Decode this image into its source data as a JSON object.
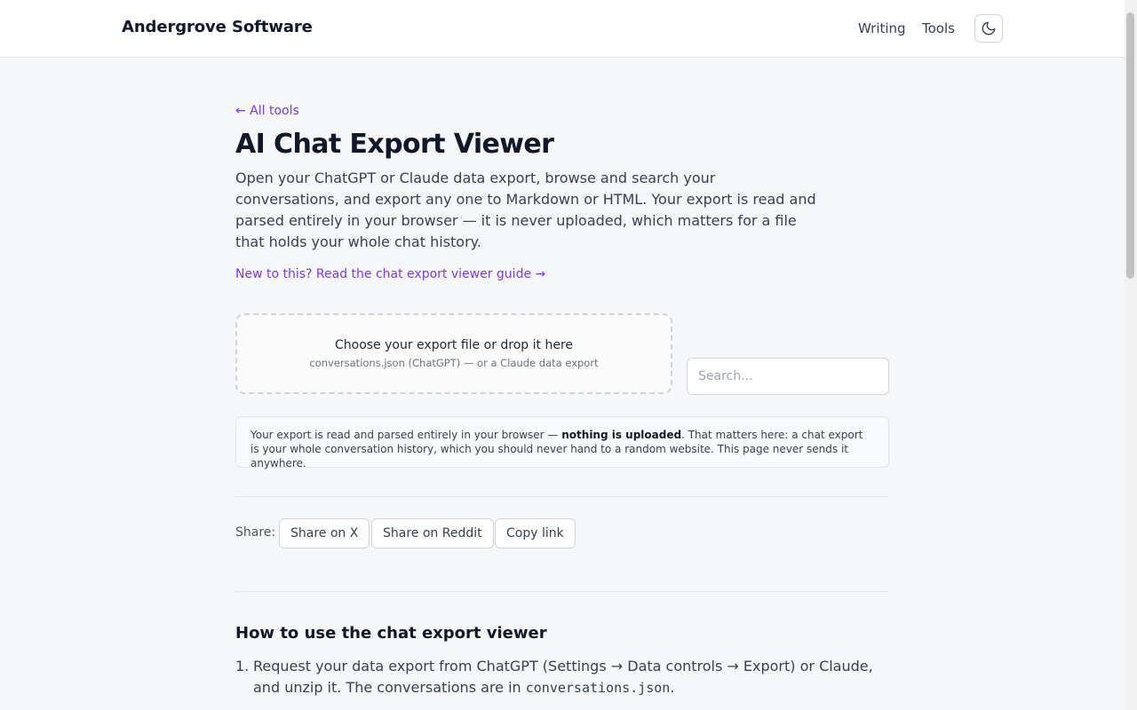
{
  "header": {
    "brand": "Andergrove Software",
    "nav": [
      {
        "label": "Writing"
      },
      {
        "label": "Tools"
      }
    ],
    "theme_toggle_icon": "moon-icon"
  },
  "main": {
    "back_link": "← All tools",
    "title": "AI Chat Export Viewer",
    "intro": "Open your ChatGPT or Claude data export, browse and search your conversations, and export any one to Markdown or HTML. Your export is read and parsed entirely in your browser — it is never uploaded, which matters for a file that holds your whole chat history.",
    "guide_link": "New to this? Read the chat export viewer guide →",
    "dropzone": {
      "title": "Choose your export file or drop it here",
      "subtitle": "conversations.json (ChatGPT) — or a Claude data export"
    },
    "search": {
      "placeholder": "Search...",
      "value": ""
    },
    "notice": {
      "before": "Your export is read and parsed entirely in your browser — ",
      "bold": "nothing is uploaded",
      "after": ". That matters here: a chat export is your whole conversation history, which you should never hand to a random website. This page never sends it anywhere."
    },
    "share": {
      "label": "Share:",
      "buttons": [
        {
          "label": "Share on X"
        },
        {
          "label": "Share on Reddit"
        },
        {
          "label": "Copy link"
        }
      ]
    },
    "howto": {
      "title": "How to use the chat export viewer",
      "steps": [
        {
          "num": "1.",
          "text_before": "Request your data export from ChatGPT (Settings → Data controls → Export) or Claude, and unzip it. The conversations are in ",
          "code": "conversations.json",
          "text_after": "."
        }
      ]
    }
  },
  "colors": {
    "accent": "#7c3aed",
    "background": "#f6f7f9",
    "text": "#1f2937"
  }
}
